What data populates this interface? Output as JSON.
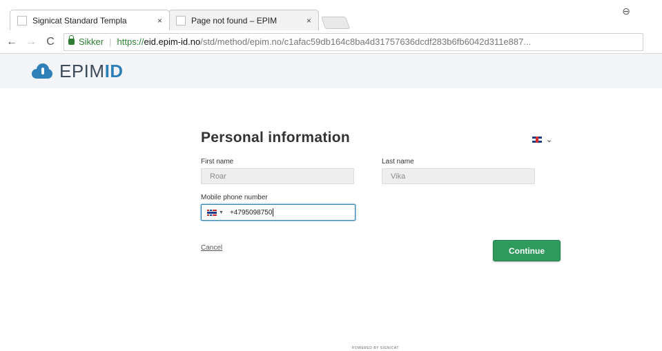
{
  "browser": {
    "tabs": [
      {
        "label": "Signicat Standard Templa",
        "close": "×",
        "active": true
      },
      {
        "label": "Page not found – EPIM",
        "close": "×",
        "active": false
      }
    ],
    "profile_icon": "⊖",
    "nav": {
      "back": "←",
      "forward": "→",
      "reload": "C"
    },
    "address": {
      "secure_label": "Sikker",
      "separator": "|",
      "scheme": "https://",
      "host": "eid.epim-id.no",
      "path": "/std/method/epim.no/c1afac59db164c8ba4d31757636dcdf283b6fb6042d311e887..."
    }
  },
  "site": {
    "brand_regular": "EPIM",
    "brand_bold": "ID"
  },
  "form": {
    "title": "Personal information",
    "language_caret": "⌄",
    "first_name": {
      "label": "First name",
      "value": "Roar"
    },
    "last_name": {
      "label": "Last name",
      "value": "Vika"
    },
    "phone": {
      "label": "Mobile phone number",
      "caret": "▼",
      "value": "+4795098750"
    },
    "cancel_label": "Cancel",
    "continue_label": "Continue"
  },
  "footer": {
    "text": "POWERED BY SIGNICAT"
  },
  "colors": {
    "brand_blue": "#2f7fb8",
    "continue_green": "#2e9a5b",
    "secure_green": "#2e7d32"
  }
}
